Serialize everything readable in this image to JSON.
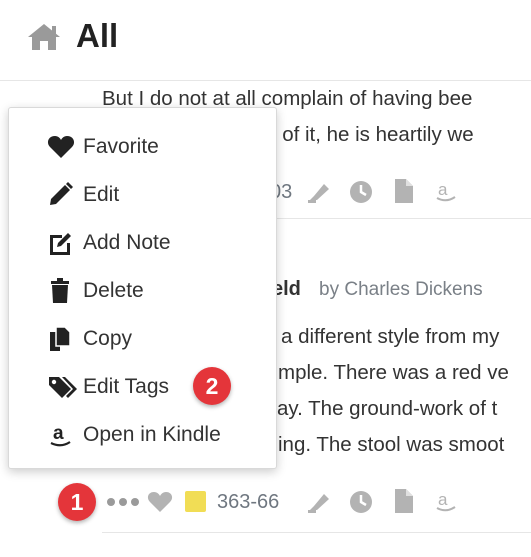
{
  "header": {
    "title": "All",
    "icon": "home-icon"
  },
  "highlight1": {
    "lines": [
      "But I do not at all complain of having bee",
      "ent of it, he is heartily we"
    ],
    "location": "03"
  },
  "book": {
    "title": "eld",
    "author": "by Charles Dickens"
  },
  "highlight2": {
    "lines": [
      "a different style from my",
      "mple. There was a red ve",
      "ay. The ground-work of t",
      "ing. The stool was smoot"
    ],
    "location": "363-66",
    "color": "#f1dd55"
  },
  "menu": {
    "items": [
      {
        "label": "Favorite",
        "icon": "heart-icon"
      },
      {
        "label": "Edit",
        "icon": "pencil-icon"
      },
      {
        "label": "Add Note",
        "icon": "edit-note-icon"
      },
      {
        "label": "Delete",
        "icon": "trash-icon"
      },
      {
        "label": "Copy",
        "icon": "copy-icon"
      },
      {
        "label": "Edit Tags",
        "icon": "tags-icon"
      },
      {
        "label": "Open in Kindle",
        "icon": "amazon-icon"
      }
    ]
  },
  "badges": {
    "first": "1",
    "second": "2",
    "color": "#e4353a"
  }
}
